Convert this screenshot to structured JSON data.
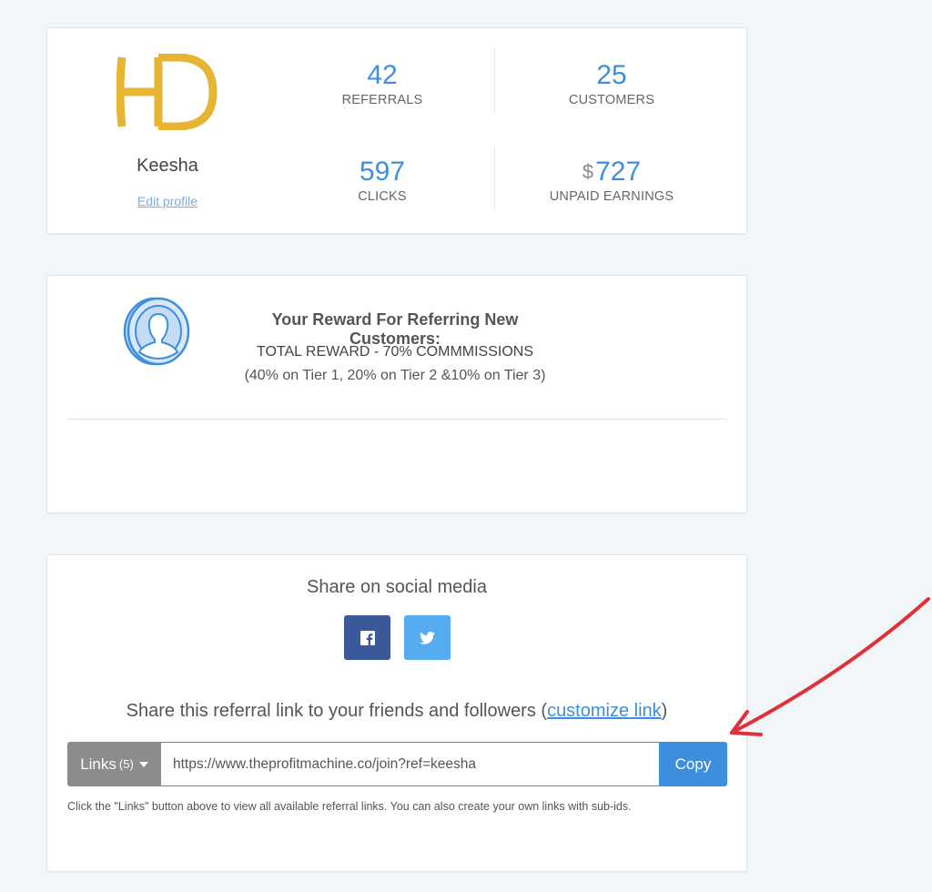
{
  "profile": {
    "logo_text": "HD",
    "name": "Keesha",
    "edit_label": "Edit profile"
  },
  "stats": {
    "referrals": {
      "value": "42",
      "label": "REFERRALS"
    },
    "customers": {
      "value": "25",
      "label": "CUSTOMERS"
    },
    "clicks": {
      "value": "597",
      "label": "CLICKS"
    },
    "earnings": {
      "currency": "$",
      "value": "727",
      "label": "UNPAID EARNINGS"
    }
  },
  "reward": {
    "icon": "user-coin-icon",
    "title": "Your Reward For Referring New Customers:",
    "total": "TOTAL REWARD - 70% COMMMISSIONS",
    "tiers": "(40% on Tier 1, 20% on Tier 2 &10% on Tier 3)"
  },
  "share": {
    "title": "Share on social media",
    "social": [
      {
        "name": "facebook",
        "icon": "facebook-icon",
        "color": "#3b5998"
      },
      {
        "name": "twitter",
        "icon": "twitter-icon",
        "color": "#55acee"
      }
    ],
    "ref_heading_prefix": "Share this referral link to your friends and followers (",
    "customize_label": "customize link",
    "ref_heading_suffix": ")",
    "links_label": "Links",
    "links_count": "(5)",
    "referral_url": "https://www.theprofitmachine.co/join?ref=keesha",
    "copy_label": "Copy",
    "help_text": "Click the \"Links\" button above to view all available referral links. You can also create your own links with sub-ids."
  },
  "colors": {
    "accent": "#3d8fde",
    "logo": "#e6b534",
    "annotation": "#e0313a"
  }
}
